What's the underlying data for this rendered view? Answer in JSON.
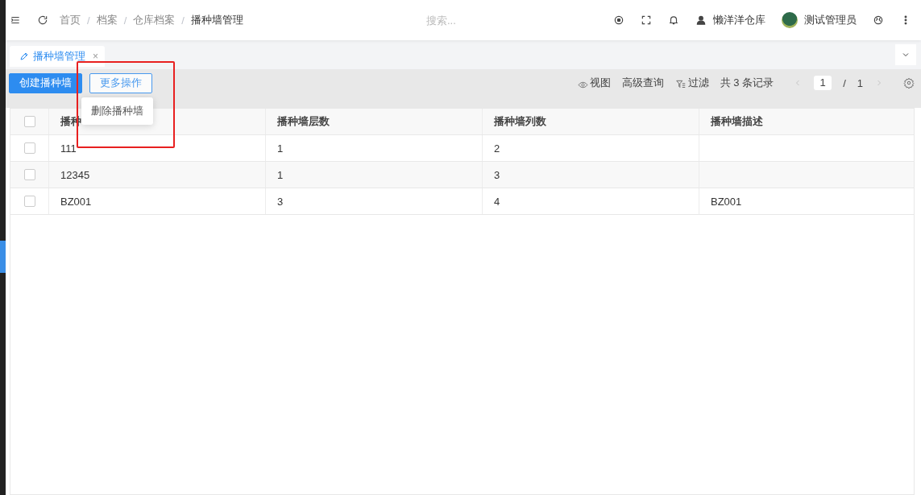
{
  "header": {
    "breadcrumb": [
      "首页",
      "档案",
      "仓库档案",
      "播种墙管理"
    ],
    "breadcrumb_separator": "/",
    "search": {
      "placeholder": "搜索..."
    },
    "warehouse": "懒洋洋仓库",
    "user": "测试管理员"
  },
  "tabs": [
    {
      "label": "播种墙管理",
      "selected": true,
      "close": "×"
    }
  ],
  "toolbar": {
    "create_button": "创建播种墙",
    "more_button": "更多操作",
    "menu": [
      "删除播种墙"
    ],
    "view": "视图",
    "advanced_search": "高级查询",
    "filter": "过滤",
    "total": "共 3 条记录",
    "page": "1",
    "page_separator": "/",
    "page_count": "1"
  },
  "table": {
    "header_checked": false,
    "columns": [
      "播种",
      "播种墙层数",
      "播种墙列数",
      "播种墙描述"
    ],
    "rows": [
      {
        "checked": false,
        "code": "111",
        "layers": "1",
        "cols": "2"
      },
      {
        "checked": false,
        "code": "12345",
        "layers": "1",
        "cols": "3"
      },
      {
        "checked": false,
        "code": "BZ001",
        "layers": "3",
        "cols": "4",
        "description": "BZ001"
      }
    ]
  }
}
